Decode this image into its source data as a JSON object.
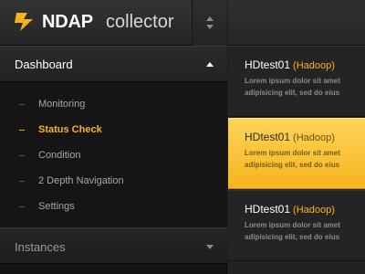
{
  "header": {
    "brand_bold": "NDAP",
    "brand_light": "collector"
  },
  "sidebar": {
    "dashboard_label": "Dashboard",
    "items": [
      {
        "label": "Monitoring",
        "active": false
      },
      {
        "label": "Status Check",
        "active": true
      },
      {
        "label": "Condition",
        "active": false
      },
      {
        "label": "2 Depth Navigation",
        "active": false
      },
      {
        "label": "Settings",
        "active": false
      }
    ],
    "instances_label": "Instances"
  },
  "list": {
    "cards": [
      {
        "name": "HDtest01",
        "type": "(Hadoop)",
        "line1": "Lorem ipsum dolor sit amet",
        "line2": "adipisicing elit, sed do eius",
        "active": false
      },
      {
        "name": "HDtest01",
        "type": "(Hadoop)",
        "line1": "Lorem ipsum dolor sit amet",
        "line2": "adipisicing elit, sed do eius",
        "active": true
      },
      {
        "name": "HDtest01",
        "type": "(Hadoop)",
        "line1": "Lorem ipsum dolor sit amet",
        "line2": "adipisicing elit, sed do eius",
        "active": false
      }
    ]
  },
  "colors": {
    "accent": "#f4b422",
    "sidebar_bg": "#141414",
    "active_card": "#f9c43a"
  },
  "icons": [
    "bolt-logo-icon",
    "up-down-switcher-icon",
    "caret-up-icon",
    "caret-down-icon"
  ]
}
